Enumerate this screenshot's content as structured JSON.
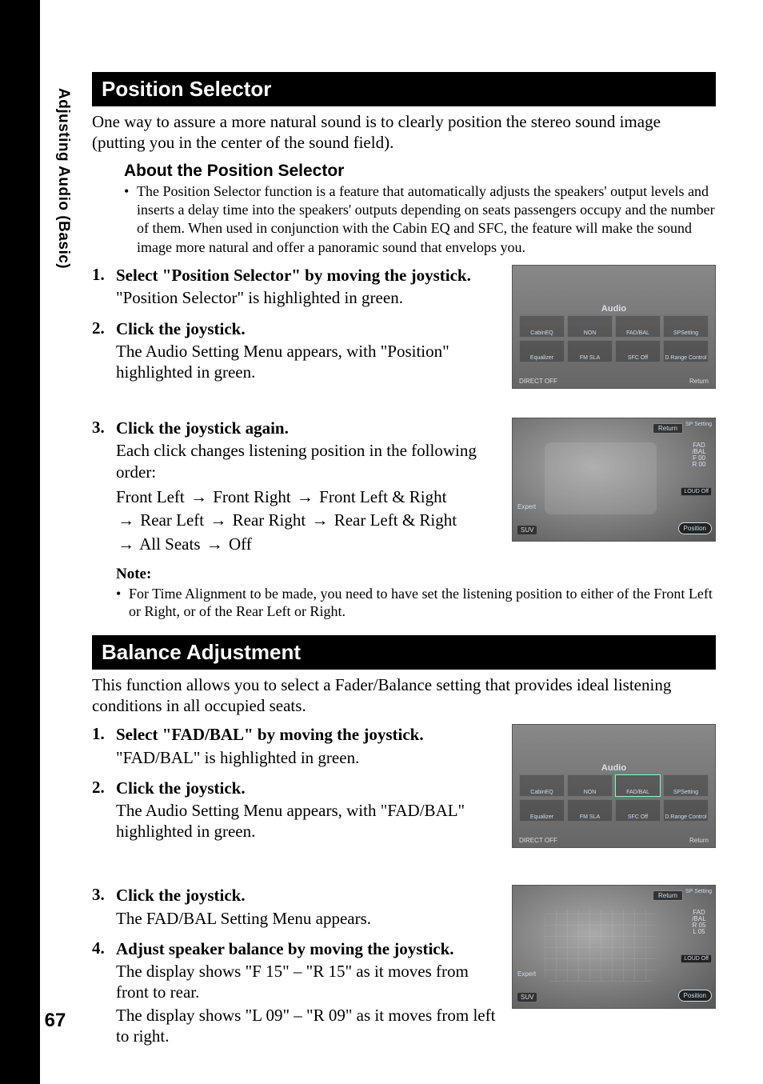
{
  "sidebar": {
    "section": "Adjusting Audio (Basic)",
    "page": "67"
  },
  "position": {
    "header": "Position Selector",
    "intro": "One way to assure a more natural sound is to clearly position the stereo sound image (putting you in the center of the sound field).",
    "about_header": "About the Position Selector",
    "about_bullet": "The Position Selector function is a feature that automatically adjusts the speakers' output levels and inserts a delay time into the speakers' outputs depending on seats passengers occupy and the number of them. When used in conjunction with the Cabin EQ and SFC, the feature will make the sound image more natural and offer a panoramic sound that envelops you.",
    "steps": [
      {
        "n": "1.",
        "title": "Select \"Position Selector\" by moving the joystick.",
        "desc": "\"Position Selector\" is highlighted in green."
      },
      {
        "n": "2.",
        "title": "Click the joystick.",
        "desc": "The Audio Setting Menu appears, with \"Position\" highlighted in green."
      },
      {
        "n": "3.",
        "title": "Click the joystick again.",
        "desc": "Each click changes listening position in the following order:"
      }
    ],
    "seq": [
      "Front Left",
      "Front Right",
      "Front Left & Right",
      "Rear Left",
      "Rear Right",
      "Rear Left & Right",
      "All Seats",
      "Off"
    ],
    "note_label": "Note:",
    "note_text": "For Time Alignment to be made, you need to have set the listening position to either of the Front Left or Right, or of the Rear Left or Right."
  },
  "balance": {
    "header": "Balance Adjustment",
    "intro": "This function allows you to select a Fader/Balance setting that provides ideal listening conditions in all occupied seats.",
    "steps": [
      {
        "n": "1.",
        "title": "Select \"FAD/BAL\" by moving the joystick.",
        "desc": "\"FAD/BAL\" is highlighted in green."
      },
      {
        "n": "2.",
        "title": "Click the joystick.",
        "desc": "The Audio Setting Menu appears, with \"FAD/BAL\" highlighted in green."
      },
      {
        "n": "3.",
        "title": "Click the joystick.",
        "desc": "The FAD/BAL Setting Menu appears."
      },
      {
        "n": "4.",
        "title": "Adjust speaker balance by moving the joystick.",
        "desc1": "The display shows \"F 15\" – \"R 15\" as it moves from front to rear.",
        "desc2": "The display shows \"L 09\" – \"R 09\" as it moves from left to right."
      }
    ]
  },
  "screens": {
    "audio_menu": {
      "title": "Audio",
      "cells": [
        "CabinEQ",
        "NON",
        "FAD/BAL",
        "SPSetting",
        "Equalizer",
        "FM SLA",
        "SFC Off",
        "D.Range Control"
      ],
      "bottom_left": "DIRECT OFF",
      "bottom_right": "Return"
    },
    "position_screen": {
      "return": "Return",
      "sp": "SP Setting",
      "fadbal": "FAD /BAL",
      "fadbal_vals": "F 00\nR 00",
      "loud": "LOUD Off",
      "pos": "Position",
      "expert": "Expert",
      "suv": "SUV"
    },
    "fadbal_screen": {
      "return": "Return",
      "sp": "SP Setting",
      "fadbal": "FAD /BAL",
      "fadbal_vals": "R 05\nL 05",
      "loud": "LOUD Off",
      "pos": "Position",
      "expert": "Expert",
      "suv": "SUV"
    }
  }
}
